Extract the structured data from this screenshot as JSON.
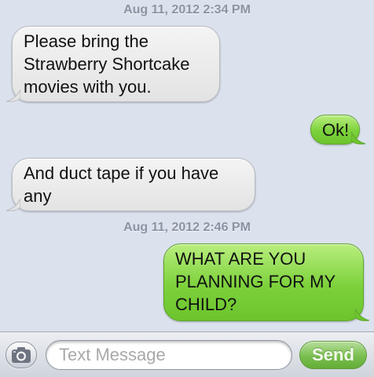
{
  "messages_thread": {
    "timestamp_1": "Aug 11, 2012 2:34 PM",
    "timestamp_2": "Aug 11, 2012 2:46 PM",
    "messages": [
      {
        "direction": "incoming",
        "lines": [
          "Please bring the",
          "Strawberry Shortcake",
          "movies with you."
        ]
      },
      {
        "direction": "outgoing",
        "lines": [
          "Ok!"
        ]
      },
      {
        "direction": "incoming",
        "lines": [
          "And duct tape if you have",
          "any"
        ]
      },
      {
        "direction": "outgoing",
        "lines": [
          "WHAT ARE YOU",
          "PLANNING FOR MY",
          "CHILD?"
        ]
      }
    ]
  },
  "composer": {
    "camera_icon": "camera-icon",
    "placeholder": "Text Message",
    "send_label": "Send"
  },
  "colors": {
    "background": "#dbe2ed",
    "incoming_bubble": "#e9e9e9",
    "outgoing_bubble": "#7cd13b",
    "send_button": "#79bf4f",
    "timestamp": "#8c93a3"
  }
}
